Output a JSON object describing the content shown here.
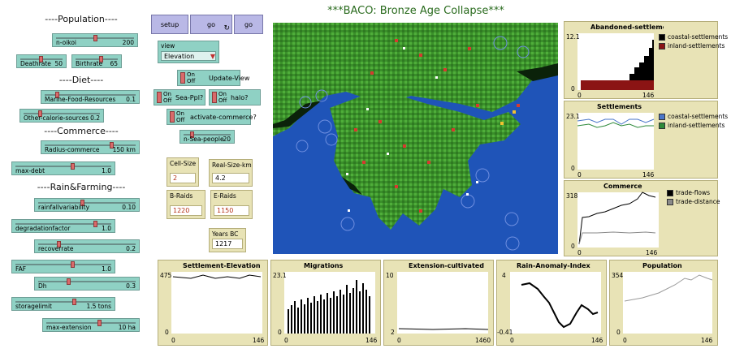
{
  "title": "***BACO: Bronze Age Collapse***",
  "sections": {
    "population": "----Population----",
    "diet": "----Diet----",
    "commerce": "----Commerce----",
    "rain": "----Rain&Farming----"
  },
  "sliders": [
    {
      "id": "n-oikoi",
      "label": "n-oikoi",
      "value": "200",
      "fraction": 0.5
    },
    {
      "id": "deathrate",
      "label": "Deathrate",
      "value": "50",
      "fraction": 0.48
    },
    {
      "id": "birthrate",
      "label": "Birthrate",
      "value": "65",
      "fraction": 0.62
    },
    {
      "id": "marine-food-resources",
      "label": "Marine-Food-Resources",
      "value": "0.1",
      "fraction": 0.12
    },
    {
      "id": "other-calorie-sources",
      "label": "Other-calorie-sources",
      "value": "0.2",
      "fraction": 0.2
    },
    {
      "id": "radius-commerce",
      "label": "Radius-commerce",
      "value": "150 km",
      "fraction": 0.75
    },
    {
      "id": "max-debt",
      "label": "max-debt",
      "value": "1.0",
      "fraction": 0.6
    },
    {
      "id": "rainfallvariability",
      "label": "rainfallvariability",
      "value": "0.10",
      "fraction": 0.45
    },
    {
      "id": "degradationfactor",
      "label": "degradationfactor",
      "value": "1.0",
      "fraction": 0.85
    },
    {
      "id": "recoverrate",
      "label": "recoverrate",
      "value": "0.2",
      "fraction": 0.2
    },
    {
      "id": "faf",
      "label": "FAF",
      "value": "1.0",
      "fraction": 0.6
    },
    {
      "id": "dh",
      "label": "Dh",
      "value": "0.3",
      "fraction": 0.3
    },
    {
      "id": "storagelimit",
      "label": "storagelimit",
      "value": "1.5 tons",
      "fraction": 0.62
    },
    {
      "id": "max-extension",
      "label": "max-extension",
      "value": "10 ha",
      "fraction": 0.6
    },
    {
      "id": "n-sea-people",
      "label": "n-Sea-people",
      "value": "20",
      "fraction": 0.15
    }
  ],
  "buttons": {
    "setup": "setup",
    "go_forever": "go",
    "go_once": "go",
    "loop_symbol": "↻"
  },
  "chooser": {
    "label": "view",
    "value": "Elevation"
  },
  "switches": {
    "on": "On",
    "off": "Off",
    "update_view": "Update-View",
    "sea_ppl": "Sea-Ppl?",
    "halo": "halo?",
    "activate_commerce": "activate-commerce?"
  },
  "monitors": [
    {
      "id": "cell-size",
      "label": "Cell-Size",
      "value": "2",
      "red": true
    },
    {
      "id": "real-size-km",
      "label": "Real-Size-km",
      "value": "4.2",
      "red": false
    },
    {
      "id": "b-raids",
      "label": "B-Raids",
      "value": "1220",
      "red": true
    },
    {
      "id": "e-raids",
      "label": "E-Raids",
      "value": "1150",
      "red": true
    },
    {
      "id": "years-bc",
      "label": "Years BC",
      "value": "1217",
      "red": false
    }
  ],
  "plots": {
    "abandoned": {
      "title": "Abandoned-settleme...",
      "ymax": "12.1",
      "ymin": "0",
      "xmin": "0",
      "xmax": "146",
      "legend": [
        {
          "name": "coastal-settlements",
          "color": "#000000"
        },
        {
          "name": "inland-settlements",
          "color": "#8b1414"
        }
      ]
    },
    "settlements": {
      "title": "Settlements",
      "ymax": "23.1",
      "ymin": "0",
      "xmin": "0",
      "xmax": "146",
      "legend": [
        {
          "name": "coastal-settlements",
          "color": "#4a76c9"
        },
        {
          "name": "inland-settlements",
          "color": "#2e8a3a"
        }
      ]
    },
    "commerce": {
      "title": "Commerce",
      "ymax": "318",
      "ymin": "0",
      "xmin": "0",
      "xmax": "146",
      "legend": [
        {
          "name": "trade-flows",
          "color": "#000000"
        },
        {
          "name": "trade-distance",
          "color": "#8a8a8a"
        }
      ]
    },
    "elevation": {
      "title": "Settlement-Elevation",
      "ymax": "475",
      "ymin": "0",
      "xmin": "0",
      "xmax": "146"
    },
    "migrations": {
      "title": "Migrations",
      "ymax": "23.1",
      "ymin": "0",
      "xmin": "0",
      "xmax": "146"
    },
    "extension": {
      "title": "Extension-cultivated",
      "ymax": "10",
      "ymin": "2",
      "xmin": "0",
      "xmax": "1460"
    },
    "rain": {
      "title": "Rain-Anomaly-Index",
      "ymax": "4",
      "ymin": "-0.41",
      "xmin": "0",
      "xmax": "146"
    },
    "population": {
      "title": "Population",
      "ymax": "354",
      "ymin": "0",
      "xmin": "0",
      "xmax": "146"
    }
  },
  "colors": {
    "slider": "#8fd1c4",
    "button": "#b9b8e6",
    "monitor": "#e8e3b6",
    "sea": "#1f54b8",
    "land": "#3f9d2f",
    "title": "#2a6b1e"
  }
}
